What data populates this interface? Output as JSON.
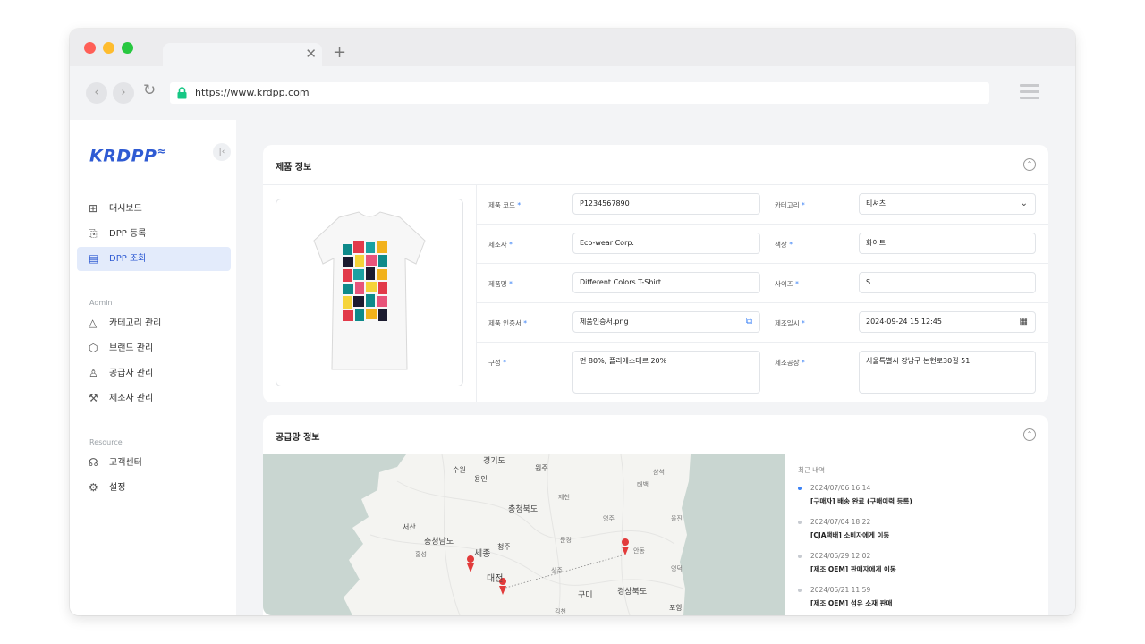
{
  "browser": {
    "url": "https://www.krdpp.com",
    "traffic_lights": [
      "#ff5f57",
      "#febc2e",
      "#28c840"
    ]
  },
  "sidebar": {
    "logo": "KRDPP",
    "items": [
      {
        "label": "대시보드",
        "icon": "grid-icon"
      },
      {
        "label": "DPP 등록",
        "icon": "add-doc-icon"
      },
      {
        "label": "DPP 조회",
        "icon": "doc-icon",
        "active": true
      }
    ],
    "admin_title": "Admin",
    "admin_items": [
      {
        "label": "카테고리 관리",
        "icon": "category-icon"
      },
      {
        "label": "브랜드 관리",
        "icon": "box-icon"
      },
      {
        "label": "공급자 관리",
        "icon": "user-icon"
      },
      {
        "label": "제조사 관리",
        "icon": "wrench-icon"
      }
    ],
    "resource_title": "Resource",
    "resource_items": [
      {
        "label": "고객센터",
        "icon": "headset-icon"
      },
      {
        "label": "설정",
        "icon": "gear-icon"
      }
    ]
  },
  "product": {
    "title": "제품 정보",
    "fields": {
      "code": {
        "label": "제품 코드",
        "value": "P1234567890"
      },
      "category": {
        "label": "카테고리",
        "value": "티셔츠"
      },
      "maker": {
        "label": "제조사",
        "value": "Eco-wear Corp."
      },
      "color": {
        "label": "색상",
        "value": "화이트"
      },
      "name": {
        "label": "제품명",
        "value": "Different Colors T-Shirt"
      },
      "size": {
        "label": "사이즈",
        "value": "S"
      },
      "cert": {
        "label": "제품 인증서",
        "value": "제품인증서.png"
      },
      "date": {
        "label": "제조일시",
        "value": "2024-09-24 15:12:45"
      },
      "composition": {
        "label": "구성",
        "value": "면 80%, 폴리에스테르 20%"
      },
      "factory": {
        "label": "제조공장",
        "value": "서울특별시 강남구 논현로30길 51"
      }
    },
    "required_mark": "*"
  },
  "supply": {
    "title": "공급망 정보",
    "history_title": "최근 내역",
    "history": [
      {
        "date": "2024/07/06 16:14",
        "text": "[구매자] 배송 완료 (구매이력 등록)"
      },
      {
        "date": "2024/07/04 18:22",
        "text": "[CJA택배] 소비자에게 이동"
      },
      {
        "date": "2024/06/29 12:02",
        "text": "[제조 OEM] 판매자에게 이동"
      },
      {
        "date": "2024/06/21 11:59",
        "text": "[제조 OEM] 섬유 소재 판매"
      }
    ],
    "map_labels": [
      "경기도",
      "수원",
      "용인",
      "원주",
      "충청북도",
      "서산",
      "충청남도",
      "세종",
      "청주",
      "대전",
      "구미",
      "경상북도",
      "포항",
      "제천",
      "영주",
      "문경",
      "상주",
      "홍성",
      "김천",
      "안동",
      "영덕",
      "삼척",
      "울진",
      "태백"
    ]
  }
}
